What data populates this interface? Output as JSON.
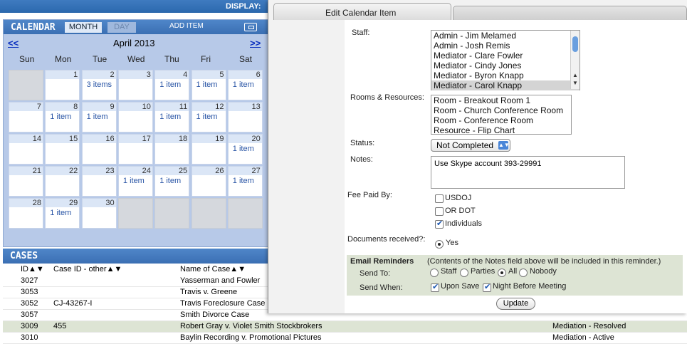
{
  "topbar": {
    "display_label": "DISPLAY:"
  },
  "calendar": {
    "title": "CALENDAR",
    "tab_month": "MONTH",
    "tab_day": "DAY",
    "add_item": "ADD ITEM",
    "prev": "<<",
    "next": ">>",
    "month_label": "April 2013",
    "weekdays": [
      "Sun",
      "Mon",
      "Tue",
      "Wed",
      "Thu",
      "Fri",
      "Sat"
    ],
    "days": [
      {
        "n": "",
        "i": ""
      },
      {
        "n": "1",
        "i": ""
      },
      {
        "n": "2",
        "i": "3 items"
      },
      {
        "n": "3",
        "i": ""
      },
      {
        "n": "4",
        "i": "1 item"
      },
      {
        "n": "5",
        "i": "1 item"
      },
      {
        "n": "6",
        "i": "1 item"
      },
      {
        "n": "7",
        "i": ""
      },
      {
        "n": "8",
        "i": "1 item"
      },
      {
        "n": "9",
        "i": "1 item"
      },
      {
        "n": "10",
        "i": ""
      },
      {
        "n": "11",
        "i": "1 item"
      },
      {
        "n": "12",
        "i": "1 item"
      },
      {
        "n": "13",
        "i": ""
      },
      {
        "n": "14",
        "i": ""
      },
      {
        "n": "15",
        "i": ""
      },
      {
        "n": "16",
        "i": ""
      },
      {
        "n": "17",
        "i": ""
      },
      {
        "n": "18",
        "i": ""
      },
      {
        "n": "19",
        "i": ""
      },
      {
        "n": "20",
        "i": "1 item"
      },
      {
        "n": "21",
        "i": ""
      },
      {
        "n": "22",
        "i": ""
      },
      {
        "n": "23",
        "i": ""
      },
      {
        "n": "24",
        "i": "1 item"
      },
      {
        "n": "25",
        "i": "1 item"
      },
      {
        "n": "26",
        "i": ""
      },
      {
        "n": "27",
        "i": "1 item"
      },
      {
        "n": "28",
        "i": ""
      },
      {
        "n": "29",
        "i": "1 item"
      },
      {
        "n": "30",
        "i": ""
      },
      {
        "n": "",
        "i": ""
      },
      {
        "n": "",
        "i": ""
      },
      {
        "n": "",
        "i": ""
      },
      {
        "n": "",
        "i": ""
      }
    ]
  },
  "cases": {
    "title": "CASES",
    "col_id": "ID▲▼",
    "col_caseid": "Case ID - other▲▼",
    "col_name": "Name of Case▲▼",
    "rows": [
      {
        "id": "3027",
        "other": "",
        "name": "Yasserman and Fowler",
        "status": ""
      },
      {
        "id": "3053",
        "other": "",
        "name": "Travis v. Greene",
        "status": ""
      },
      {
        "id": "3052",
        "other": "CJ-43267-I",
        "name": "Travis Foreclosure Case",
        "status": ""
      },
      {
        "id": "3057",
        "other": "",
        "name": "Smith Divorce Case",
        "status": ""
      },
      {
        "id": "3009",
        "other": "455",
        "name": "Robert Gray v. Violet Smith Stockbrokers",
        "status": "Mediation - Resolved"
      },
      {
        "id": "3010",
        "other": "",
        "name": "Baylin Recording v. Promotional Pictures",
        "status": "Mediation - Active"
      }
    ]
  },
  "modal": {
    "tab_title": "Edit Calendar Item",
    "staff_label": "Staff:",
    "staff": [
      "Admin - Jim Melamed",
      "Admin - Josh Remis",
      "Mediator - Clare Fowler",
      "Mediator - Cindy Jones",
      "Mediator - Byron Knapp",
      "Mediator - Carol Knapp"
    ],
    "rooms_label": "Rooms & Resources:",
    "rooms": [
      "Room - Breakout Room 1",
      "Room - Church Conference Room",
      "Room - Conference Room",
      "Resource - Flip Chart"
    ],
    "status_label": "Status:",
    "status_value": "Not Completed",
    "notes_label": "Notes:",
    "notes_value": "Use Skype account 393-29991",
    "fee_label": "Fee Paid By:",
    "fee_options": [
      {
        "label": "USDOJ",
        "checked": false
      },
      {
        "label": "OR DOT",
        "checked": false
      },
      {
        "label": "Individuals",
        "checked": true
      }
    ],
    "docs_label": "Documents received?:",
    "docs_yes": "Yes",
    "email_title": "Email Reminders",
    "email_note": "(Contents of the Notes field above will be included in this reminder.)",
    "send_to_label": "Send To:",
    "send_to": [
      {
        "label": "Staff",
        "on": false
      },
      {
        "label": "Parties",
        "on": false
      },
      {
        "label": "All",
        "on": true
      },
      {
        "label": "Nobody",
        "on": false
      }
    ],
    "send_when_label": "Send When:",
    "send_when": [
      {
        "label": "Upon Save",
        "checked": true
      },
      {
        "label": "Night Before Meeting",
        "checked": true
      }
    ],
    "update_label": "Update"
  }
}
